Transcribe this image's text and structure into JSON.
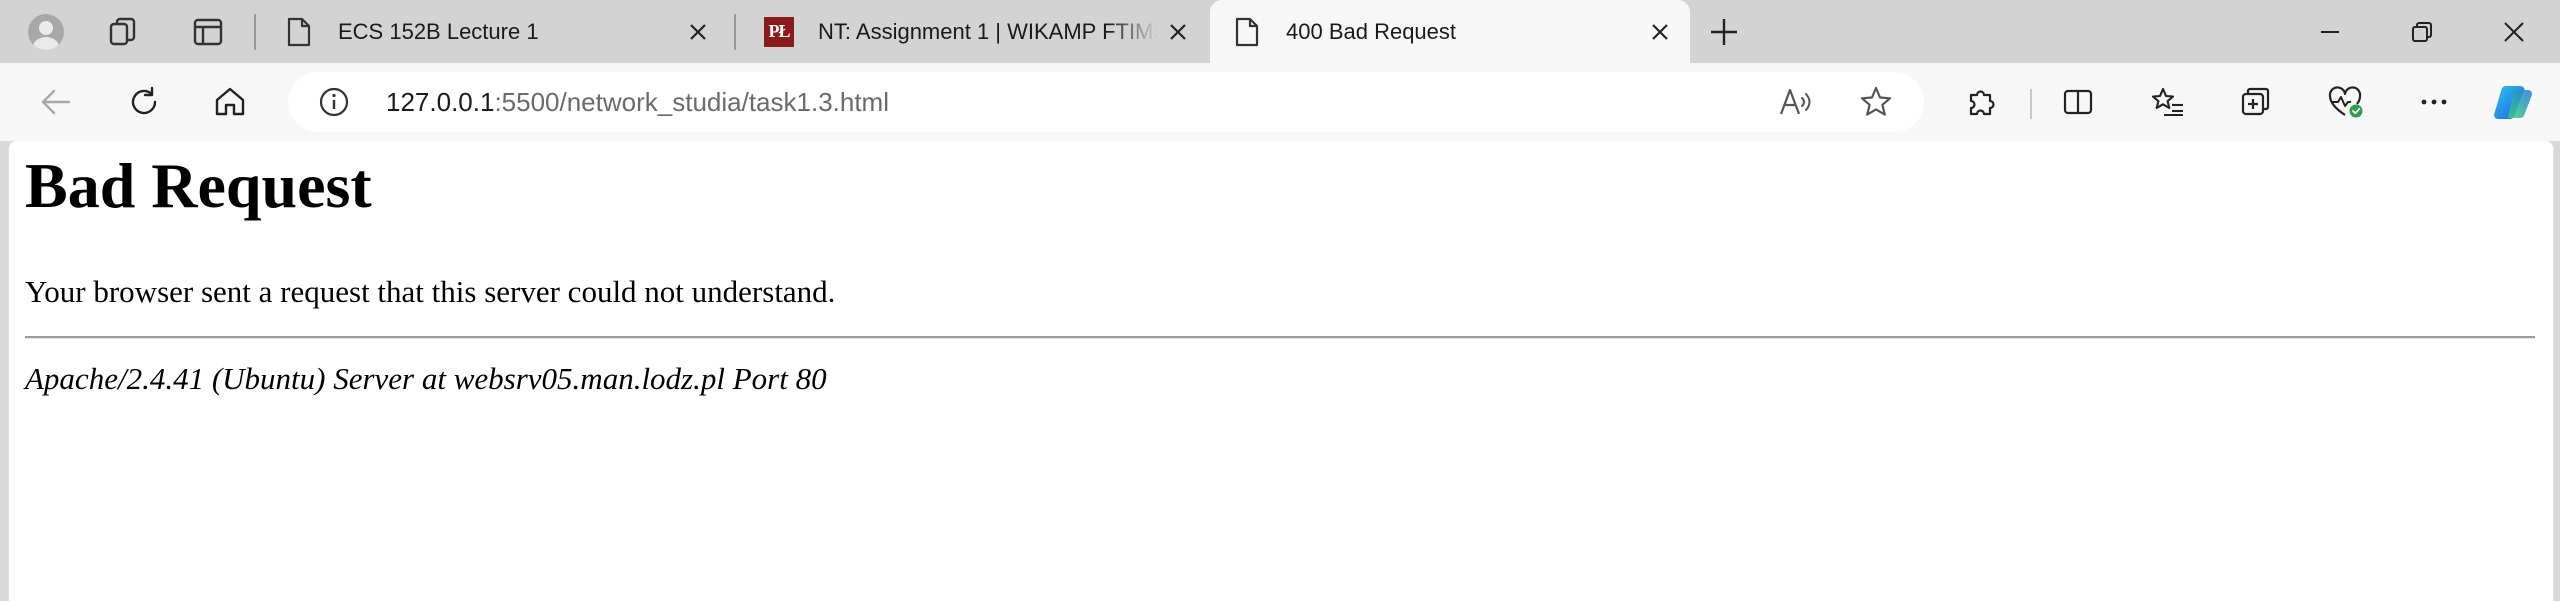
{
  "tabs": [
    {
      "title": "ECS 152B Lecture 1",
      "favicon": "page-icon",
      "active": false
    },
    {
      "title": "NT: Assignment 1 | WIKAMP FTIMS",
      "favicon": "pl-logo",
      "favicon_text": "PŁ",
      "active": false
    },
    {
      "title": "400 Bad Request",
      "favicon": "page-icon",
      "active": true
    }
  ],
  "address_bar": {
    "host": "127.0.0.1",
    "rest": ":5500/network_studia/task1.3.html"
  },
  "page": {
    "heading": "Bad Request",
    "message": "Your browser sent a request that this server could not understand.",
    "server_signature": "Apache/2.4.41 (Ubuntu) Server at websrv05.man.lodz.pl Port 80"
  },
  "colors": {
    "tabstrip_bg": "#d3d3d3",
    "toolbar_bg": "#f7f7f7",
    "pl_logo_bg": "#8b1a1a",
    "copilot_blue": "#1f7ae0"
  }
}
